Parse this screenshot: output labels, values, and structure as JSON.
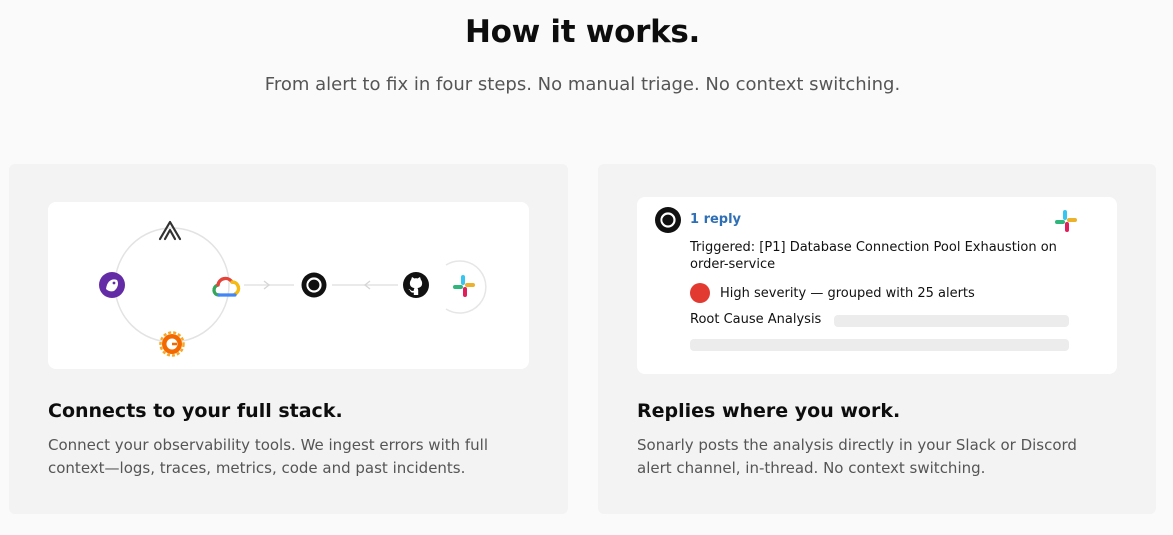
{
  "hero": {
    "title": "How it works.",
    "subtitle": "From alert to fix in four steps. No manual triage. No context switching."
  },
  "cards": [
    {
      "title": "Connects to your full stack.",
      "description": "Connect your observability tools. We ingest errors with full context—logs, traces, metrics, code and past incidents.",
      "integrations": [
        "sentry-icon",
        "datadog-icon",
        "google-cloud-icon",
        "grafana-icon",
        "sonarly-icon",
        "github-icon",
        "slack-icon"
      ]
    },
    {
      "title": "Replies where you work.",
      "description": "Sonarly posts the analysis directly in your Slack or Discord alert channel, in-thread. No context switching.",
      "thread": {
        "reply_count": "1 reply",
        "message": "Triggered: [P1] Database Connection Pool Exhaustion on order-service",
        "severity": "High severity — grouped with 25 alerts",
        "section_label": "Root Cause Analysis"
      }
    }
  ],
  "colors": {
    "background": "#fafafa",
    "card": "#f3f3f3",
    "link": "#2f6fb5",
    "severity": "#e23a30"
  }
}
